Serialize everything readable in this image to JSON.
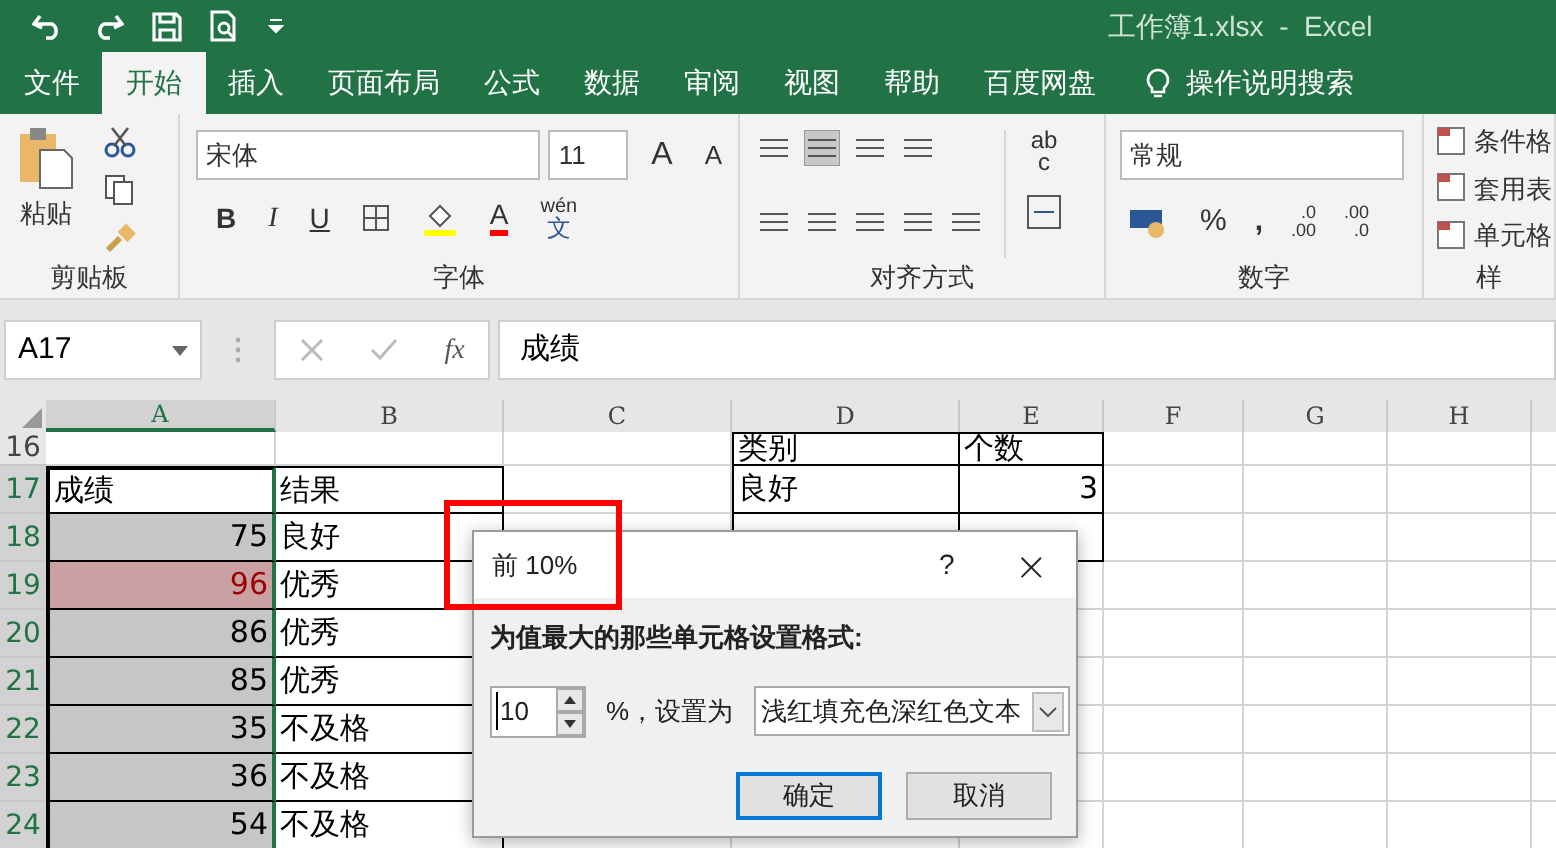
{
  "window": {
    "title": "工作簿1.xlsx  -  Excel"
  },
  "tabs": [
    {
      "label": "文件",
      "selected": false
    },
    {
      "label": "开始",
      "selected": true
    },
    {
      "label": "插入",
      "selected": false
    },
    {
      "label": "页面布局",
      "selected": false
    },
    {
      "label": "公式",
      "selected": false
    },
    {
      "label": "数据",
      "selected": false
    },
    {
      "label": "审阅",
      "selected": false
    },
    {
      "label": "视图",
      "selected": false
    },
    {
      "label": "帮助",
      "selected": false
    },
    {
      "label": "百度网盘",
      "selected": false
    }
  ],
  "tell_me": "操作说明搜索",
  "ribbon": {
    "clipboard": {
      "paste": "粘贴",
      "group": "剪贴板"
    },
    "font": {
      "name": "宋体",
      "size": "11",
      "grow": "A",
      "shrink": "A",
      "bold": "B",
      "italic": "I",
      "underline": "U",
      "font_color": "A",
      "phonetic_top": "wén",
      "phonetic_bottom": "文",
      "group": "字体"
    },
    "alignment": {
      "wrap_top": "ab",
      "wrap_bottom": "c",
      "group": "对齐方式"
    },
    "number": {
      "format": "常规",
      "percent": "%",
      "comma": ",",
      "increase_top": ".0",
      "increase_bottom": ".00",
      "decrease_top": ".00",
      "decrease_bottom": ".0",
      "group": "数字"
    },
    "styles": {
      "items": [
        "条件格",
        "套用表",
        "单元格"
      ],
      "group": "样"
    }
  },
  "formula_bar": {
    "name_box": "A17",
    "fx": "fx",
    "value": "成绩"
  },
  "columns": [
    {
      "label": "A",
      "selected": true
    },
    {
      "label": "B",
      "selected": false
    },
    {
      "label": "C",
      "selected": false
    },
    {
      "label": "D",
      "selected": false
    },
    {
      "label": "E",
      "selected": false
    },
    {
      "label": "F",
      "selected": false
    },
    {
      "label": "G",
      "selected": false
    },
    {
      "label": "H",
      "selected": false
    }
  ],
  "row_headers": [
    {
      "label": "16",
      "selected": false
    },
    {
      "label": "17",
      "selected": true
    },
    {
      "label": "18",
      "selected": true
    },
    {
      "label": "19",
      "selected": true
    },
    {
      "label": "20",
      "selected": true
    },
    {
      "label": "21",
      "selected": true
    },
    {
      "label": "22",
      "selected": true
    },
    {
      "label": "23",
      "selected": true
    },
    {
      "label": "24",
      "selected": true
    }
  ],
  "left_table": {
    "rows": [
      [
        {
          "text": "成绩",
          "kind": "text",
          "selected": true,
          "active": true,
          "highlighted": false
        },
        {
          "text": "结果",
          "kind": "text",
          "selected": false,
          "active": false,
          "highlighted": false
        }
      ],
      [
        {
          "text": "75",
          "kind": "number",
          "selected": true,
          "active": false,
          "highlighted": false
        },
        {
          "text": "良好",
          "kind": "text",
          "selected": false,
          "active": false,
          "highlighted": false
        }
      ],
      [
        {
          "text": "96",
          "kind": "number",
          "selected": true,
          "active": false,
          "highlighted": true
        },
        {
          "text": "优秀",
          "kind": "text",
          "selected": false,
          "active": false,
          "highlighted": false
        }
      ],
      [
        {
          "text": "86",
          "kind": "number",
          "selected": true,
          "active": false,
          "highlighted": false
        },
        {
          "text": "优秀",
          "kind": "text",
          "selected": false,
          "active": false,
          "highlighted": false
        }
      ],
      [
        {
          "text": "85",
          "kind": "number",
          "selected": true,
          "active": false,
          "highlighted": false
        },
        {
          "text": "优秀",
          "kind": "text",
          "selected": false,
          "active": false,
          "highlighted": false
        }
      ],
      [
        {
          "text": "35",
          "kind": "number",
          "selected": true,
          "active": false,
          "highlighted": false
        },
        {
          "text": "不及格",
          "kind": "text",
          "selected": false,
          "active": false,
          "highlighted": false
        }
      ],
      [
        {
          "text": "36",
          "kind": "number",
          "selected": true,
          "active": false,
          "highlighted": false
        },
        {
          "text": "不及格",
          "kind": "text",
          "selected": false,
          "active": false,
          "highlighted": false
        }
      ],
      [
        {
          "text": "54",
          "kind": "number",
          "selected": true,
          "active": false,
          "highlighted": false
        },
        {
          "text": "不及格",
          "kind": "text",
          "selected": false,
          "active": false,
          "highlighted": false
        }
      ]
    ]
  },
  "right_table": {
    "rows": [
      [
        {
          "text": "类别",
          "kind": "text"
        },
        {
          "text": "个数",
          "kind": "text"
        }
      ],
      [
        {
          "text": "良好",
          "kind": "text"
        },
        {
          "text": "3",
          "kind": "number"
        }
      ],
      [
        {
          "kind": "blank"
        },
        {
          "kind": "blank"
        }
      ]
    ]
  },
  "dialog": {
    "title": "前 10%",
    "help": "?",
    "close": "×",
    "prompt": "为值最大的那些单元格设置格式:",
    "value": "10",
    "unit": "%，设置为",
    "format": "浅红填充色深红色文本",
    "buttons": [
      {
        "label": "确定",
        "default": true
      },
      {
        "label": "取消",
        "default": false
      }
    ]
  }
}
